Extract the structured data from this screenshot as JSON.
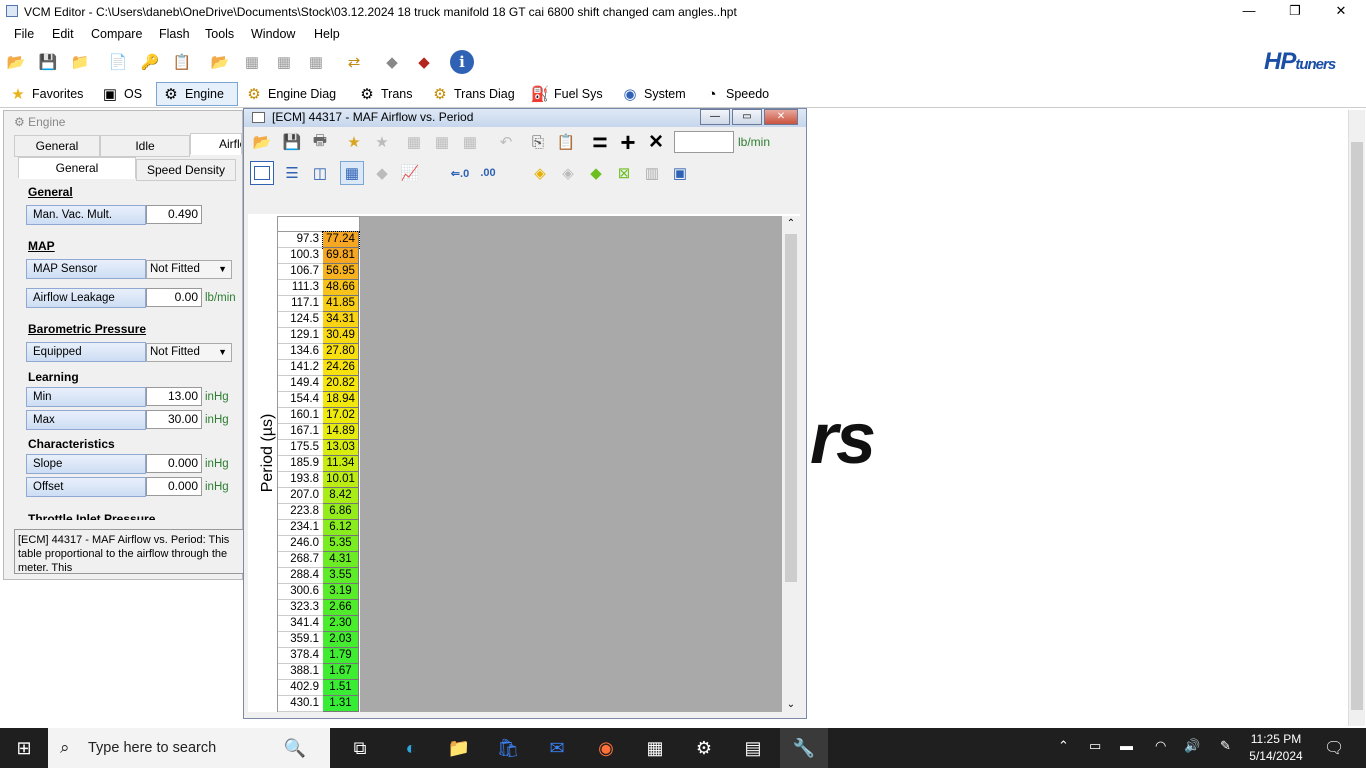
{
  "window": {
    "title": "VCM Editor - C:\\Users\\daneb\\OneDrive\\Documents\\Stock\\03.12.2024 18 truck manifold 18 GT cai 6800 shift changed cam angles..hpt",
    "min_label": "—",
    "max_label": "❐",
    "close_label": "✕"
  },
  "menu": [
    "File",
    "Edit",
    "Compare",
    "Flash",
    "Tools",
    "Window",
    "Help"
  ],
  "logo": {
    "hp": "HP",
    "tuners": "tuners"
  },
  "nav_tabs": [
    {
      "label": "Favorites",
      "icon": "star-icon"
    },
    {
      "label": "OS",
      "icon": "chip-icon"
    },
    {
      "label": "Engine",
      "icon": "engine-icon"
    },
    {
      "label": "Engine Diag",
      "icon": "engine-diag-icon"
    },
    {
      "label": "Trans",
      "icon": "gear-icon"
    },
    {
      "label": "Trans Diag",
      "icon": "gear-diag-icon"
    },
    {
      "label": "Fuel Sys",
      "icon": "fuel-pump-icon"
    },
    {
      "label": "System",
      "icon": "system-icon"
    },
    {
      "label": "Speedo",
      "icon": "speedometer-icon"
    }
  ],
  "engine_panel": {
    "header": "Engine",
    "tabs_top": [
      "General",
      "Idle",
      "Airflo"
    ],
    "tabs_sub": [
      "General",
      "Speed Density"
    ],
    "sections": {
      "general": "General",
      "map": "MAP",
      "baro": "Barometric Pressure",
      "learning": "Learning",
      "characteristics": "Characteristics",
      "throttle": "Throttle Inlet Pressure"
    },
    "fields": {
      "man_vac_mult": {
        "label": "Man. Vac. Mult.",
        "value": "0.490"
      },
      "map_sensor": {
        "label": "MAP Sensor",
        "value": "Not Fitted"
      },
      "airflow_leakage": {
        "label": "Airflow Leakage",
        "value": "0.00",
        "unit": "lb/min"
      },
      "equipped": {
        "label": "Equipped",
        "value": "Not Fitted"
      },
      "min": {
        "label": "Min",
        "value": "13.00",
        "unit": "inHg"
      },
      "max": {
        "label": "Max",
        "value": "30.00",
        "unit": "inHg"
      },
      "slope": {
        "label": "Slope",
        "value": "0.000",
        "unit": "inHg"
      },
      "offset": {
        "label": "Offset",
        "value": "0.000",
        "unit": "inHg"
      }
    },
    "description": "[ECM] 44317 - MAF Airflow vs. Period: This table proportional to the airflow through the meter. This"
  },
  "maf_window": {
    "title": "[ECM] 44317 - MAF Airflow vs. Period",
    "unit": "lb/min",
    "axis_label": "Period (µs)",
    "rows": [
      {
        "period": "97.3",
        "value": "77.24",
        "color": "#f5a623"
      },
      {
        "period": "100.3",
        "value": "69.81",
        "color": "#f5a623"
      },
      {
        "period": "106.7",
        "value": "56.95",
        "color": "#f6b21f"
      },
      {
        "period": "111.3",
        "value": "48.66",
        "color": "#f7c21a"
      },
      {
        "period": "117.1",
        "value": "41.85",
        "color": "#f8cd16"
      },
      {
        "period": "124.5",
        "value": "34.31",
        "color": "#f8d414"
      },
      {
        "period": "129.1",
        "value": "30.49",
        "color": "#f8da12"
      },
      {
        "period": "134.6",
        "value": "27.80",
        "color": "#f8df10"
      },
      {
        "period": "141.2",
        "value": "24.26",
        "color": "#f7e20f"
      },
      {
        "period": "149.4",
        "value": "20.82",
        "color": "#f5e60e"
      },
      {
        "period": "154.4",
        "value": "18.94",
        "color": "#f2e80e"
      },
      {
        "period": "160.1",
        "value": "17.02",
        "color": "#eeea0e"
      },
      {
        "period": "167.1",
        "value": "14.89",
        "color": "#e6ec0f"
      },
      {
        "period": "175.5",
        "value": "13.03",
        "color": "#d9ec10"
      },
      {
        "period": "185.9",
        "value": "11.34",
        "color": "#c8ec12"
      },
      {
        "period": "193.8",
        "value": "10.01",
        "color": "#bbec14"
      },
      {
        "period": "207.0",
        "value": "8.42",
        "color": "#a8ec18"
      },
      {
        "period": "223.8",
        "value": "6.86",
        "color": "#94ec1c"
      },
      {
        "period": "234.1",
        "value": "6.12",
        "color": "#88ec1f"
      },
      {
        "period": "246.0",
        "value": "5.35",
        "color": "#7aec22"
      },
      {
        "period": "268.7",
        "value": "4.31",
        "color": "#6cec25"
      },
      {
        "period": "288.4",
        "value": "3.55",
        "color": "#5fec28"
      },
      {
        "period": "300.6",
        "value": "3.19",
        "color": "#58ec2a"
      },
      {
        "period": "323.3",
        "value": "2.66",
        "color": "#50ec2c"
      },
      {
        "period": "341.4",
        "value": "2.30",
        "color": "#4aec2e"
      },
      {
        "period": "359.1",
        "value": "2.03",
        "color": "#45ec30"
      },
      {
        "period": "378.4",
        "value": "1.79",
        "color": "#40ec31"
      },
      {
        "period": "388.1",
        "value": "1.67",
        "color": "#3eec32"
      },
      {
        "period": "402.9",
        "value": "1.51",
        "color": "#3aec33"
      },
      {
        "period": "430.1",
        "value": "1.31",
        "color": "#36ec34"
      }
    ]
  },
  "background_logo": "rs",
  "taskbar": {
    "search_placeholder": "Type here to search",
    "time": "11:25 PM",
    "date": "5/14/2024"
  }
}
